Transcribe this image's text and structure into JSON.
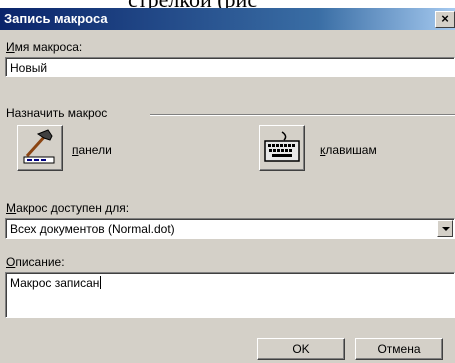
{
  "clipped_text": "стрелкой (рис",
  "window": {
    "title": "Запись макроса",
    "close_glyph": "×"
  },
  "macro_name": {
    "label_accel": "И",
    "label_rest": "мя макроса:",
    "value": "Новый"
  },
  "assign": {
    "label": "Назначить макрос",
    "toolbar_accel": "п",
    "toolbar_rest": "анели",
    "keyboard_accel": "к",
    "keyboard_rest": "лавишам"
  },
  "store": {
    "label_accel": "М",
    "label_rest": "акрос доступен для:",
    "selected": "Всех документов (Normal.dot)"
  },
  "description": {
    "label_accel": "О",
    "label_rest": "писание:",
    "value": "Макрос записан"
  },
  "buttons": {
    "ok": "OK",
    "cancel": "Отмена"
  },
  "icons": {
    "toolbar": "hammer-icon",
    "keyboard": "keyboard-icon",
    "close": "close-icon",
    "dropdown": "chevron-down-icon"
  }
}
